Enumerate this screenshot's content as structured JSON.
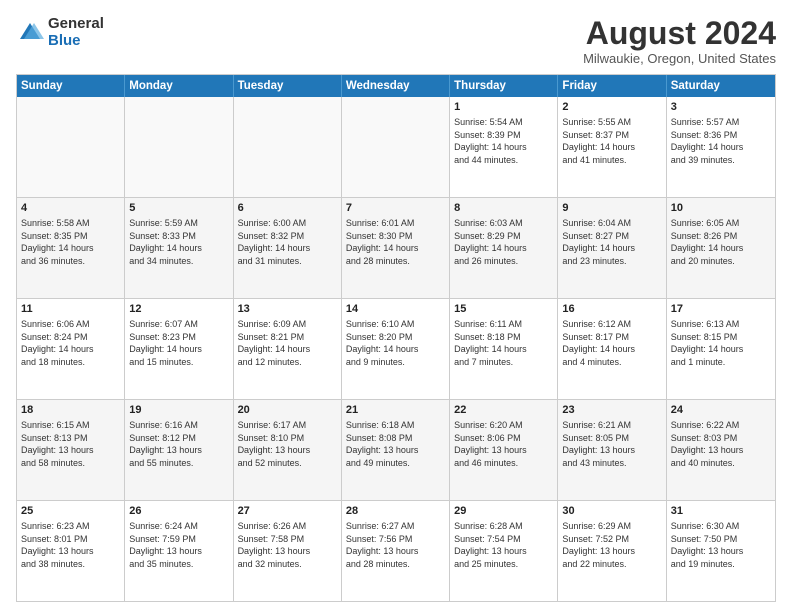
{
  "logo": {
    "general": "General",
    "blue": "Blue"
  },
  "title": "August 2024",
  "subtitle": "Milwaukie, Oregon, United States",
  "days": [
    "Sunday",
    "Monday",
    "Tuesday",
    "Wednesday",
    "Thursday",
    "Friday",
    "Saturday"
  ],
  "weeks": [
    [
      {
        "day": "",
        "info": ""
      },
      {
        "day": "",
        "info": ""
      },
      {
        "day": "",
        "info": ""
      },
      {
        "day": "",
        "info": ""
      },
      {
        "day": "1",
        "info": "Sunrise: 5:54 AM\nSunset: 8:39 PM\nDaylight: 14 hours\nand 44 minutes."
      },
      {
        "day": "2",
        "info": "Sunrise: 5:55 AM\nSunset: 8:37 PM\nDaylight: 14 hours\nand 41 minutes."
      },
      {
        "day": "3",
        "info": "Sunrise: 5:57 AM\nSunset: 8:36 PM\nDaylight: 14 hours\nand 39 minutes."
      }
    ],
    [
      {
        "day": "4",
        "info": "Sunrise: 5:58 AM\nSunset: 8:35 PM\nDaylight: 14 hours\nand 36 minutes."
      },
      {
        "day": "5",
        "info": "Sunrise: 5:59 AM\nSunset: 8:33 PM\nDaylight: 14 hours\nand 34 minutes."
      },
      {
        "day": "6",
        "info": "Sunrise: 6:00 AM\nSunset: 8:32 PM\nDaylight: 14 hours\nand 31 minutes."
      },
      {
        "day": "7",
        "info": "Sunrise: 6:01 AM\nSunset: 8:30 PM\nDaylight: 14 hours\nand 28 minutes."
      },
      {
        "day": "8",
        "info": "Sunrise: 6:03 AM\nSunset: 8:29 PM\nDaylight: 14 hours\nand 26 minutes."
      },
      {
        "day": "9",
        "info": "Sunrise: 6:04 AM\nSunset: 8:27 PM\nDaylight: 14 hours\nand 23 minutes."
      },
      {
        "day": "10",
        "info": "Sunrise: 6:05 AM\nSunset: 8:26 PM\nDaylight: 14 hours\nand 20 minutes."
      }
    ],
    [
      {
        "day": "11",
        "info": "Sunrise: 6:06 AM\nSunset: 8:24 PM\nDaylight: 14 hours\nand 18 minutes."
      },
      {
        "day": "12",
        "info": "Sunrise: 6:07 AM\nSunset: 8:23 PM\nDaylight: 14 hours\nand 15 minutes."
      },
      {
        "day": "13",
        "info": "Sunrise: 6:09 AM\nSunset: 8:21 PM\nDaylight: 14 hours\nand 12 minutes."
      },
      {
        "day": "14",
        "info": "Sunrise: 6:10 AM\nSunset: 8:20 PM\nDaylight: 14 hours\nand 9 minutes."
      },
      {
        "day": "15",
        "info": "Sunrise: 6:11 AM\nSunset: 8:18 PM\nDaylight: 14 hours\nand 7 minutes."
      },
      {
        "day": "16",
        "info": "Sunrise: 6:12 AM\nSunset: 8:17 PM\nDaylight: 14 hours\nand 4 minutes."
      },
      {
        "day": "17",
        "info": "Sunrise: 6:13 AM\nSunset: 8:15 PM\nDaylight: 14 hours\nand 1 minute."
      }
    ],
    [
      {
        "day": "18",
        "info": "Sunrise: 6:15 AM\nSunset: 8:13 PM\nDaylight: 13 hours\nand 58 minutes."
      },
      {
        "day": "19",
        "info": "Sunrise: 6:16 AM\nSunset: 8:12 PM\nDaylight: 13 hours\nand 55 minutes."
      },
      {
        "day": "20",
        "info": "Sunrise: 6:17 AM\nSunset: 8:10 PM\nDaylight: 13 hours\nand 52 minutes."
      },
      {
        "day": "21",
        "info": "Sunrise: 6:18 AM\nSunset: 8:08 PM\nDaylight: 13 hours\nand 49 minutes."
      },
      {
        "day": "22",
        "info": "Sunrise: 6:20 AM\nSunset: 8:06 PM\nDaylight: 13 hours\nand 46 minutes."
      },
      {
        "day": "23",
        "info": "Sunrise: 6:21 AM\nSunset: 8:05 PM\nDaylight: 13 hours\nand 43 minutes."
      },
      {
        "day": "24",
        "info": "Sunrise: 6:22 AM\nSunset: 8:03 PM\nDaylight: 13 hours\nand 40 minutes."
      }
    ],
    [
      {
        "day": "25",
        "info": "Sunrise: 6:23 AM\nSunset: 8:01 PM\nDaylight: 13 hours\nand 38 minutes."
      },
      {
        "day": "26",
        "info": "Sunrise: 6:24 AM\nSunset: 7:59 PM\nDaylight: 13 hours\nand 35 minutes."
      },
      {
        "day": "27",
        "info": "Sunrise: 6:26 AM\nSunset: 7:58 PM\nDaylight: 13 hours\nand 32 minutes."
      },
      {
        "day": "28",
        "info": "Sunrise: 6:27 AM\nSunset: 7:56 PM\nDaylight: 13 hours\nand 28 minutes."
      },
      {
        "day": "29",
        "info": "Sunrise: 6:28 AM\nSunset: 7:54 PM\nDaylight: 13 hours\nand 25 minutes."
      },
      {
        "day": "30",
        "info": "Sunrise: 6:29 AM\nSunset: 7:52 PM\nDaylight: 13 hours\nand 22 minutes."
      },
      {
        "day": "31",
        "info": "Sunrise: 6:30 AM\nSunset: 7:50 PM\nDaylight: 13 hours\nand 19 minutes."
      }
    ]
  ]
}
